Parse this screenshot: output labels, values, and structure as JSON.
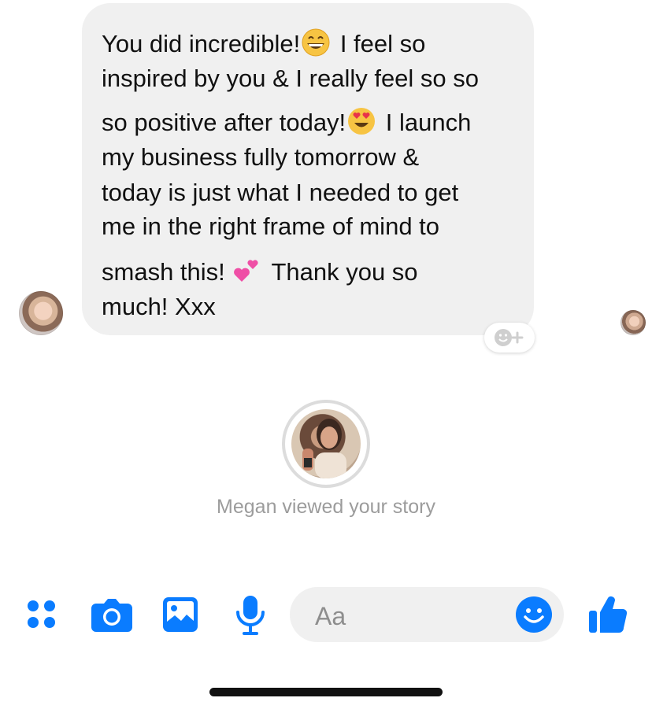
{
  "message": {
    "lines": [
      {
        "before": "You did incredible!",
        "emoji": "grinning-face",
        "after": " I feel so"
      },
      {
        "before": "inspired by you & I really feel so so",
        "emoji": null,
        "after": ""
      },
      {
        "before": "so positive after today!",
        "emoji": "heart-eyes-face",
        "after": " I launch"
      },
      {
        "before": "my business fully tomorrow &",
        "emoji": null,
        "after": ""
      },
      {
        "before": "today is just what I needed to get",
        "emoji": null,
        "after": ""
      },
      {
        "before": "me in the right frame of mind to",
        "emoji": null,
        "after": ""
      },
      {
        "before": "smash this! ",
        "emoji": "two-hearts",
        "after": " Thank you so"
      },
      {
        "before": "much! Xxx",
        "emoji": null,
        "after": ""
      }
    ]
  },
  "story": {
    "caption": "Megan viewed your story"
  },
  "composer": {
    "placeholder": "Aa"
  },
  "colors": {
    "accent": "#0a7cff",
    "bubble": "#f0f0f0",
    "caption": "#9c9c9c"
  },
  "icons": {
    "menu": "four-dots-icon",
    "camera": "camera-icon",
    "gallery": "image-icon",
    "mic": "microphone-icon",
    "emoji": "smiley-icon",
    "like": "thumbs-up-icon",
    "react": "add-reaction-icon"
  }
}
